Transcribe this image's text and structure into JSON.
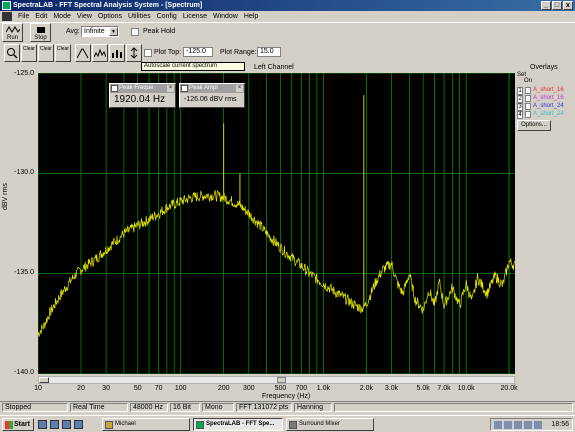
{
  "window": {
    "title": "SpectraLAB - FFT Spectral Analysis System - [Spectrum]",
    "controls": [
      "_",
      "□",
      "x"
    ]
  },
  "menu": [
    "File",
    "Edit",
    "Mode",
    "View",
    "Options",
    "Utilities",
    "Config",
    "License",
    "Window",
    "Help"
  ],
  "toolbar": {
    "run_label": "Run",
    "stop_label": "Stop",
    "avg_label": "Avg:",
    "avg_value": "Infinite",
    "peak_hold_label": "Peak Hold",
    "plot_top_label": "Plot Top:",
    "plot_top_value": "-125.0",
    "plot_range_label": "Plot Range:",
    "plot_range_value": "15.0",
    "small_buttons": [
      "Clear",
      "Clear",
      "Clear"
    ],
    "tooltip": "Autoscale current spectrum"
  },
  "plot": {
    "channel_label": "Left Channel",
    "y_title": "dBV rms",
    "x_title": "Frequency (Hz)",
    "y_ticks": [
      "-125.0",
      "-130.0",
      "-135.0",
      "-140.0"
    ],
    "x_ticks": [
      "10",
      "20",
      "30",
      "50",
      "70",
      "100",
      "200",
      "300",
      "500",
      "700",
      "1.0k",
      "2.0k",
      "3.0k",
      "5.0k",
      "7.0k",
      "10.0k",
      "20.0k"
    ],
    "background_color": "#000000",
    "trace_color": "#e6e600",
    "grid_color": "#00a000"
  },
  "chart_data": {
    "type": "line",
    "title": "Left Channel",
    "xlabel": "Frequency (Hz)",
    "ylabel": "dBV rms",
    "x_scale": "log",
    "xlim": [
      10,
      22000
    ],
    "ylim": [
      -140,
      -125
    ],
    "grid": true,
    "series": [
      {
        "name": "Left Channel",
        "x": [
          10,
          11,
          12,
          14,
          16,
          18,
          20,
          25,
          30,
          40,
          50,
          60,
          70,
          80,
          100,
          120,
          150,
          170,
          200,
          230,
          260,
          300,
          350,
          400,
          500,
          600,
          700,
          800,
          1000,
          1200,
          1400,
          1600,
          1800,
          1900,
          2000,
          2300,
          2600,
          3000,
          3300,
          3600,
          4000,
          4400,
          5000,
          5500,
          6000,
          6500,
          7000,
          8000,
          9000,
          10000,
          11000,
          12000,
          14000,
          16000,
          18000,
          20000,
          22000
        ],
        "y": [
          -138.0,
          -137.6,
          -137.0,
          -136.2,
          -135.6,
          -135.1,
          -134.8,
          -134.3,
          -133.8,
          -133.0,
          -132.6,
          -132.3,
          -132.0,
          -131.7,
          -131.4,
          -131.2,
          -131.1,
          -131.1,
          -131.2,
          -131.4,
          -131.6,
          -132.0,
          -132.5,
          -133.0,
          -133.7,
          -134.2,
          -134.6,
          -135.0,
          -135.5,
          -135.9,
          -136.2,
          -136.5,
          -136.7,
          -136.7,
          -136.5,
          -135.5,
          -134.8,
          -134.5,
          -135.5,
          -136.0,
          -135.0,
          -136.3,
          -136.8,
          -135.8,
          -136.6,
          -135.4,
          -136.6,
          -135.7,
          -136.6,
          -135.5,
          -136.4,
          -135.2,
          -136.0,
          -135.1,
          -135.6,
          -134.4,
          -134.6
        ]
      }
    ],
    "spikes": [
      {
        "x": 200,
        "y": -127.5
      },
      {
        "x": 260,
        "y": -130.0
      },
      {
        "x": 1920,
        "y": -126.1
      }
    ]
  },
  "peak_freq": {
    "title": "Peak Freque",
    "value": "1920.04 Hz"
  },
  "peak_amp": {
    "title": "Peak Ampl",
    "value": "-126.06 dBV rms"
  },
  "overlays": {
    "title": "Overlays",
    "set_label": "Set",
    "on_label": "On",
    "items": [
      {
        "num": "1",
        "name": "A_short_16",
        "color": "#e03030"
      },
      {
        "num": "2",
        "name": "A_short_16",
        "color": "#c030c0"
      },
      {
        "num": "3",
        "name": "A_short_24",
        "color": "#3030e0"
      },
      {
        "num": "4",
        "name": "A_short_24",
        "color": "#30c0c0"
      }
    ],
    "options_label": "Options..."
  },
  "status": {
    "state": "Stopped",
    "mode": "Real Time",
    "rate": "48000 Hz",
    "bits": "16 Bit",
    "channels": "Mono",
    "fft": "FFT 131072 pts",
    "window": "Hanning"
  },
  "taskbar": {
    "start": "Start",
    "tasks": [
      "Michael",
      "SpectraLAB - FFT Spe...",
      "Surround Mixer"
    ],
    "clock": "18:56"
  }
}
